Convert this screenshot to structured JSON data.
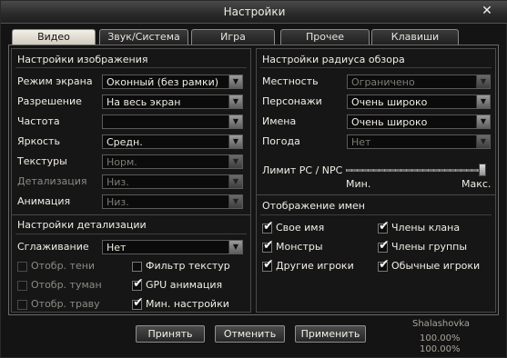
{
  "window": {
    "title": "Настройки"
  },
  "tabs": [
    {
      "label": "Видео",
      "active": true
    },
    {
      "label": "Звук/Система",
      "active": false
    },
    {
      "label": "Игра",
      "active": false
    },
    {
      "label": "Прочее",
      "active": false
    },
    {
      "label": "Клавиши",
      "active": false
    }
  ],
  "image_settings": {
    "title": "Настройки изображения",
    "rows": [
      {
        "label": "Режим экрана",
        "value": "Оконный (без рамки)",
        "enabled": true
      },
      {
        "label": "Разрешение",
        "value": "На весь экран",
        "enabled": true
      },
      {
        "label": "Частота",
        "value": "",
        "enabled": true
      },
      {
        "label": "Яркость",
        "value": "Средн.",
        "enabled": true
      },
      {
        "label": "Текстуры",
        "value": "Норм.",
        "enabled": false
      },
      {
        "label": "Детализация",
        "value": "Низ.",
        "enabled": false
      },
      {
        "label": "Анимация",
        "value": "Низ.",
        "enabled": false
      }
    ]
  },
  "detail_settings": {
    "title": "Настройки детализации",
    "antialias_label": "Сглаживание",
    "antialias_value": "Нет",
    "checkboxes": [
      {
        "label": "Отобр. тени",
        "checked": false,
        "enabled": false
      },
      {
        "label": "Фильтр текстур",
        "checked": false,
        "enabled": true
      },
      {
        "label": "Отобр. туман",
        "checked": false,
        "enabled": false
      },
      {
        "label": "GPU анимация",
        "checked": true,
        "enabled": true
      },
      {
        "label": "Отобр. траву",
        "checked": false,
        "enabled": false
      },
      {
        "label": "Мин. настройки",
        "checked": true,
        "enabled": true
      }
    ]
  },
  "view_range": {
    "title": "Настройки радиуса обзора",
    "rows": [
      {
        "label": "Местность",
        "value": "Ограничено",
        "enabled": false
      },
      {
        "label": "Персонажи",
        "value": "Очень широко",
        "enabled": true
      },
      {
        "label": "Имена",
        "value": "Очень широко",
        "enabled": true
      },
      {
        "label": "Погода",
        "value": "Нет",
        "enabled": false
      }
    ],
    "limit_label": "Лимит PC / NPC",
    "min_label": "Мин.",
    "max_label": "Макс.",
    "limit_value_fraction": 1.0
  },
  "name_display": {
    "title": "Отображение имен",
    "checkboxes": [
      {
        "label": "Свое имя",
        "checked": true
      },
      {
        "label": "Члены клана",
        "checked": true
      },
      {
        "label": "Монстры",
        "checked": true
      },
      {
        "label": "Члены группы",
        "checked": true
      },
      {
        "label": "Другие игроки",
        "checked": true
      },
      {
        "label": "Обычные игроки",
        "checked": true
      }
    ]
  },
  "buttons": {
    "accept": "Принять",
    "cancel": "Отменить",
    "apply": "Применить"
  },
  "background": {
    "name": "Shalashovka",
    "hp": "100.00%",
    "mp": "100.00%"
  },
  "colors": {
    "panel_bg": "#141414",
    "text": "#f1eee5",
    "disabled_text": "#8d8a84",
    "tab_active": "#e6e2d6"
  }
}
